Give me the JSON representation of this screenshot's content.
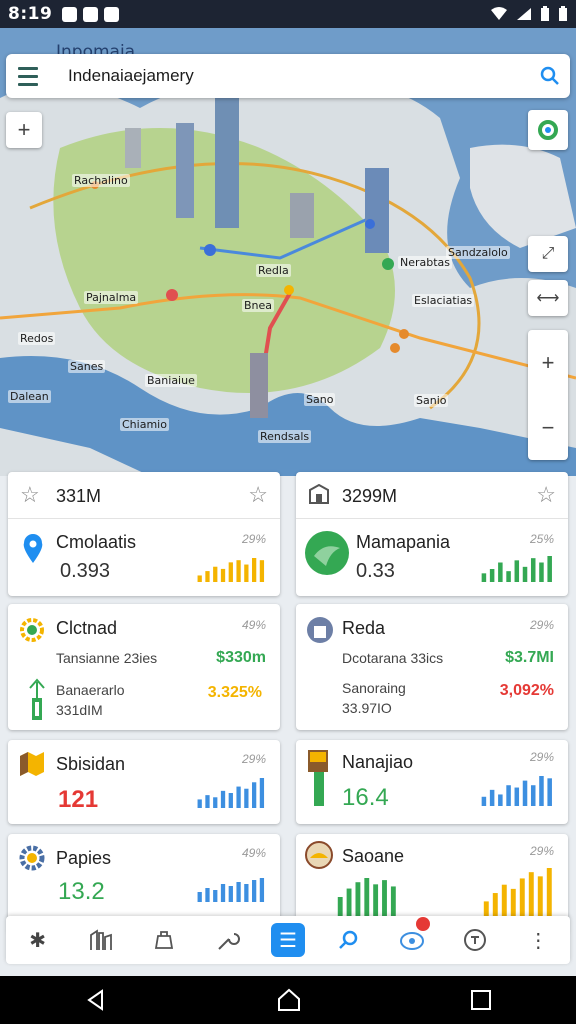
{
  "status_bar": {
    "time": "8:19"
  },
  "search": {
    "title": "Indenaiaejamery",
    "under_title": "Inpomaia"
  },
  "map_labels": [
    "Rachalino",
    "Pajnalma",
    "Redos",
    "Sanes",
    "Baniaiue",
    "Bnea",
    "Redla",
    "Chiamio",
    "Dalean",
    "Rendsals",
    "Sano",
    "Nerabtas",
    "Eslaciatias",
    "Sanio",
    "Sandzalolo"
  ],
  "cards": {
    "left_header": {
      "value": "331M"
    },
    "right_header": {
      "value": "3299M"
    },
    "c1": {
      "title": "Cmolaatis",
      "pct": "29%",
      "value": "0.393",
      "color": "#f4b400"
    },
    "c2": {
      "title": "Mamapania",
      "pct": "25%",
      "value": "0.33",
      "color": "#34a853"
    },
    "c3": {
      "title": "Clctnad",
      "pct": "49%",
      "sub1": "Tansianne 23ies",
      "delta1": "$330m",
      "sub2": "Banaerarlo",
      "sub3": "331dIM",
      "delta2": "3.325%"
    },
    "c4": {
      "title": "Reda",
      "pct": "29%",
      "sub1": "Dcotarana 33ics",
      "delta1": "$3.7MI",
      "sub2": "Sanoraing",
      "sub3": "33.97IO",
      "delta2": "3,092%"
    },
    "c5": {
      "title": "Sbisidan",
      "pct": "29%",
      "value": "121",
      "color": "#e53935"
    },
    "c6": {
      "title": "Nanajiao",
      "pct": "29%",
      "value": "16.4",
      "color": "#34a853"
    },
    "c7": {
      "title": "Papies",
      "pct": "49%",
      "value": "13.2",
      "color": "#34a853"
    },
    "c8": {
      "title": "Saoane",
      "pct": "29%"
    }
  },
  "colors": {
    "accent": "#1f8ef0",
    "green": "#34a853",
    "red": "#e53935",
    "amber": "#f4b400",
    "blue_bar": "#3d8fe0"
  },
  "bottom_nav": [
    "wind-icon",
    "building-icon",
    "bag-icon",
    "wrench-icon",
    "list-icon",
    "search-icon",
    "gift-icon",
    "clock-icon",
    "more-icon"
  ]
}
